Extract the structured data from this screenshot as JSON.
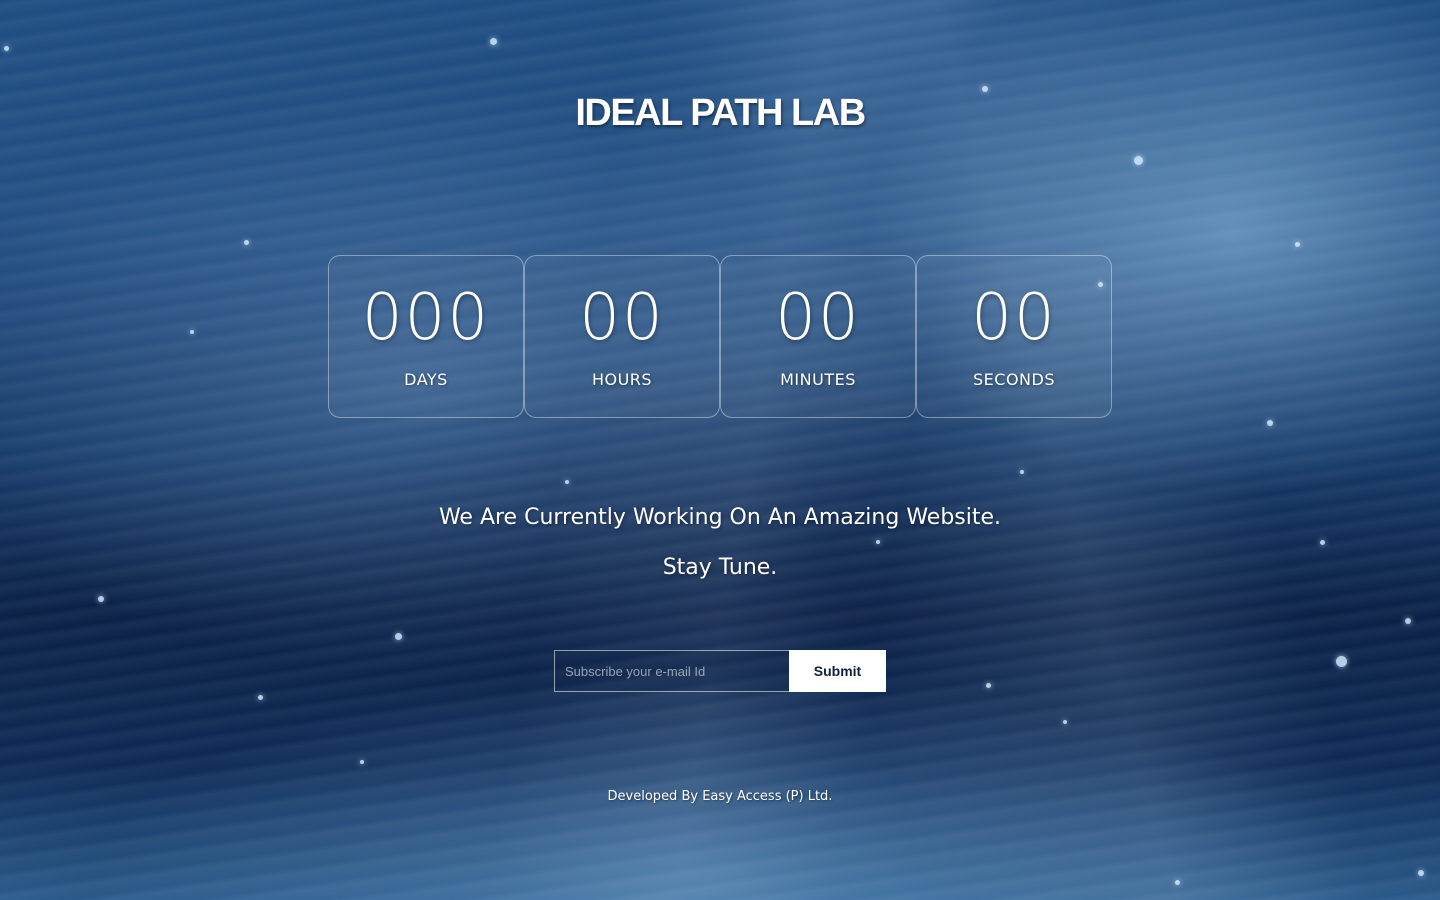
{
  "header": {
    "title": "IDEAL PATH LAB"
  },
  "countdown": [
    {
      "value": "000",
      "label": "DAYS"
    },
    {
      "value": "00",
      "label": "HOURS"
    },
    {
      "value": "00",
      "label": "MINUTES"
    },
    {
      "value": "00",
      "label": "SECONDS"
    }
  ],
  "message": {
    "line1": "We Are Currently Working On An Amazing Website.",
    "line2": "Stay Tune."
  },
  "subscribe": {
    "placeholder": "Subscribe your e-mail Id",
    "value": "",
    "button_label": "Submit"
  },
  "footer": {
    "credit": "Developed By Easy Access (P) Ltd."
  },
  "colors": {
    "background_top": "#1e4d82",
    "background_bottom": "#0b2147",
    "button_bg": "#ffffff",
    "button_text": "#0e2240"
  }
}
